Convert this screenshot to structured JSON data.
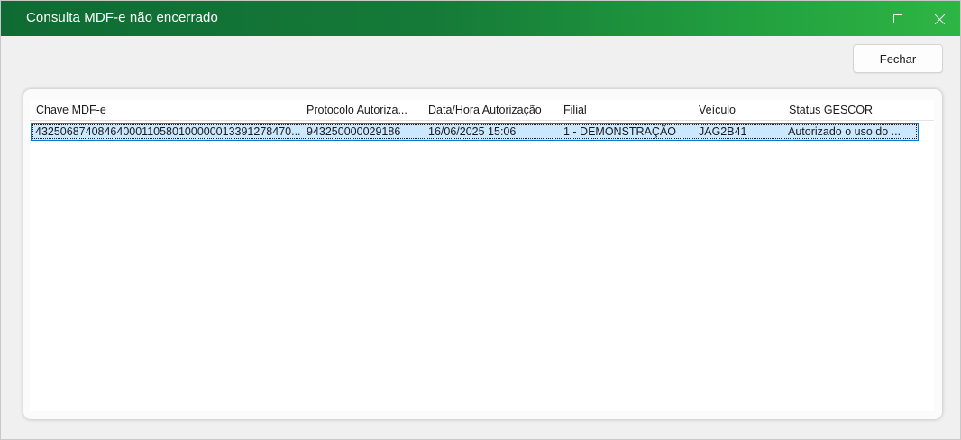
{
  "window": {
    "title": "Consulta MDF-e não encerrado"
  },
  "toolbar": {
    "close_label": "Fechar"
  },
  "table": {
    "columns": [
      "Chave MDF-e",
      "Protocolo Autoriza...",
      "Data/Hora Autorização",
      "Filial",
      "Veículo",
      "Status GESCOR"
    ],
    "rows": [
      {
        "chave": "43250687408464000110580100000013391278470...",
        "protocolo": "943250000029186",
        "data_hora": "16/06/2025 15:06",
        "filial": "1 - DEMONSTRAÇÃO",
        "veiculo": "JAG2B41",
        "status": "Autorizado o uso do ..."
      }
    ]
  },
  "colors": {
    "titlebar_start": "#0f6b33",
    "titlebar_end": "#2fb544",
    "selection_fill": "#cce8ff",
    "selection_border": "#0078d7"
  }
}
